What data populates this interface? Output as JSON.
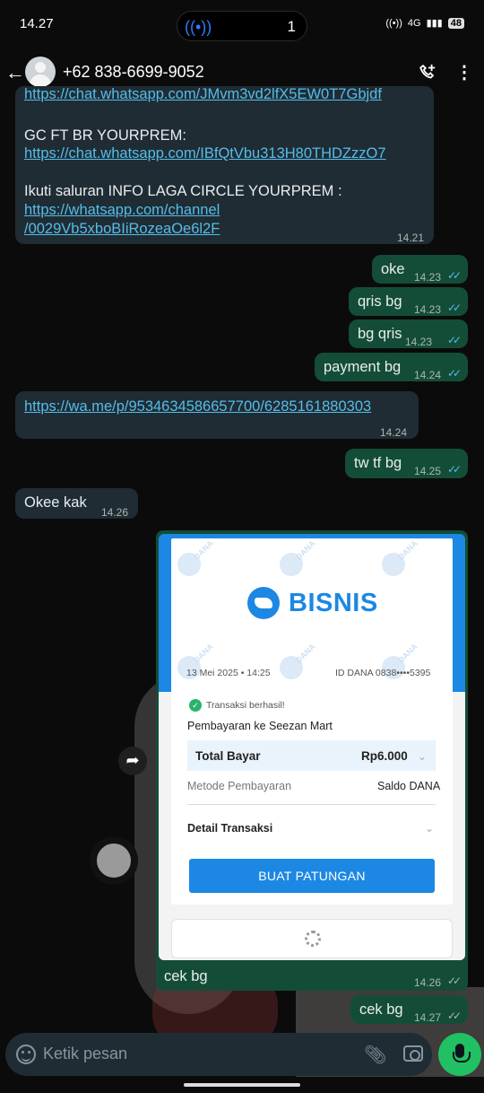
{
  "status_bar": {
    "time": "14.27",
    "notification_count": "1",
    "network": "4G",
    "battery": "48"
  },
  "header": {
    "contact_name": "+62 838-6699-9052",
    "back_icon": "arrow-left-icon",
    "call_icon": "add-call-icon",
    "menu_icon": "more-vertical-icon"
  },
  "messages": {
    "m1": {
      "partial_link": "https://chat.whatsapp.com/JMvm3vd2lfX5EW0T7Gbjdf",
      "gc_label": "GC FT BR YOURPREM:",
      "gc_link": "https://chat.whatsapp.com/IBfQtVbu313H80THDZzzO7",
      "channel_label": "Ikuti saluran INFO LAGA CIRCLE YOURPREM :",
      "channel_link_line1": "https://whatsapp.com/channel",
      "channel_link_line2": "/0029Vb5xboBIiRozeaOe6l2F",
      "time": "14.21"
    },
    "m2": {
      "text": "oke",
      "time": "14.23"
    },
    "m3": {
      "text": "qris bg",
      "time": "14.23"
    },
    "m4": {
      "text": "bg qris",
      "time": "14.23"
    },
    "m5": {
      "text": "payment bg",
      "time": "14.24"
    },
    "m6": {
      "text": "https://wa.me/p/9534634586657700/6285161880303",
      "time": "14.24"
    },
    "m7": {
      "text": "tw tf bg",
      "time": "14.25"
    },
    "m8": {
      "text": "Okee kak",
      "time": "14.26"
    },
    "m9": {
      "caption": "cek bg",
      "time": "14.26",
      "receipt": {
        "brand": "BISNIS",
        "watermark": "DANA",
        "date": "13 Mei 2025 • 14:25",
        "id": "ID DANA 0838••••5395",
        "status": "Transaksi berhasil!",
        "merchant": "Pembayaran ke Seezan Mart",
        "total_label": "Total Bayar",
        "total_value": "Rp6.000",
        "method_label": "Metode Pembayaran",
        "method_value": "Saldo DANA",
        "detail_label": "Detail Transaksi",
        "button": "BUAT PATUNGAN"
      }
    },
    "m10": {
      "text": "cek bg",
      "time": "14.27"
    }
  },
  "composer": {
    "placeholder": "Ketik pesan"
  }
}
